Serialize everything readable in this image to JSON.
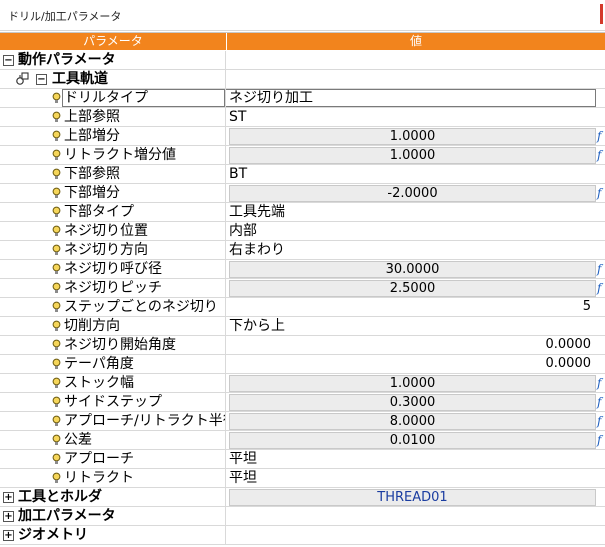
{
  "window": {
    "title": "ドリル/加工パラメータ",
    "accent_color": "#d4392b"
  },
  "header": {
    "col_param": "パラメータ",
    "col_value": "値",
    "color": "#f2841d"
  },
  "group_motion": {
    "label": "動作パラメータ",
    "toggle": "−"
  },
  "group_toolpath": {
    "label": "工具軌道",
    "toggle": "−"
  },
  "rows": [
    {
      "name": "ドリルタイプ",
      "value": "ネジ切り加工",
      "kind": "text"
    },
    {
      "name": "上部参照",
      "value": "ST",
      "kind": "text"
    },
    {
      "name": "上部増分",
      "value": "1.0000",
      "kind": "num"
    },
    {
      "name": "リトラクト増分値",
      "value": "1.0000",
      "kind": "num"
    },
    {
      "name": "下部参照",
      "value": "BT",
      "kind": "text"
    },
    {
      "name": "下部増分",
      "value": "-2.0000",
      "kind": "num"
    },
    {
      "name": "下部タイプ",
      "value": "工具先端",
      "kind": "text"
    },
    {
      "name": "ネジ切り位置",
      "value": "内部",
      "kind": "text"
    },
    {
      "name": "ネジ切り方向",
      "value": "右まわり",
      "kind": "text"
    },
    {
      "name": "ネジ切り呼び径",
      "value": "30.0000",
      "kind": "num"
    },
    {
      "name": "ネジ切りピッチ",
      "value": "2.5000",
      "kind": "num"
    },
    {
      "name": "ステップごとのネジ切り",
      "value": "5",
      "kind": "right"
    },
    {
      "name": "切削方向",
      "value": "下から上",
      "kind": "text"
    },
    {
      "name": "ネジ切り開始角度",
      "value": "0.0000",
      "kind": "right"
    },
    {
      "name": "テーパ角度",
      "value": "0.0000",
      "kind": "right"
    },
    {
      "name": "ストック幅",
      "value": "1.0000",
      "kind": "num"
    },
    {
      "name": "サイドステップ",
      "value": "0.3000",
      "kind": "num"
    },
    {
      "name": "アプローチ/リトラクト半径",
      "value": "8.0000",
      "kind": "num"
    },
    {
      "name": "公差",
      "value": "0.0100",
      "kind": "num"
    },
    {
      "name": "アプローチ",
      "value": "平坦",
      "kind": "text"
    },
    {
      "name": "リトラクト",
      "value": "平坦",
      "kind": "text"
    }
  ],
  "group_tool": {
    "label": "工具とホルダ",
    "value": "THREAD01",
    "toggle": "+"
  },
  "group_machining": {
    "label": "加工パラメータ",
    "toggle": "+"
  },
  "group_geometry": {
    "label": "ジオメトリ",
    "toggle": "+"
  },
  "fx_symbol": "f"
}
